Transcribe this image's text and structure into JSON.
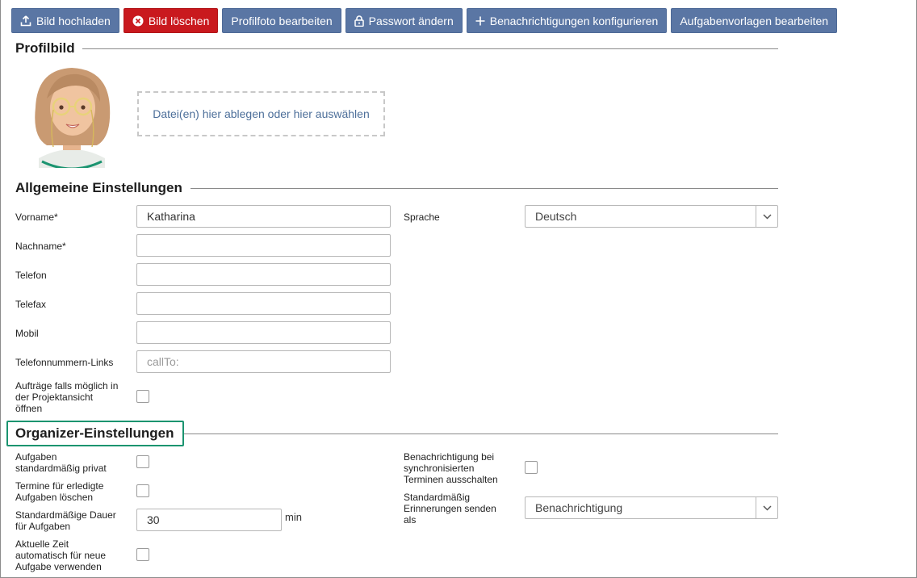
{
  "toolbar": {
    "upload": {
      "label": "Bild hochladen",
      "icon": "upload-icon"
    },
    "delete": {
      "label": "Bild löschen",
      "icon": "close-circle-icon",
      "color": "#c9191e"
    },
    "edit_photo": {
      "label": "Profilfoto bearbeiten"
    },
    "password": {
      "label": "Passwort ändern",
      "icon": "lock-icon"
    },
    "notifications": {
      "label": "Benachrichtigungen konfigurieren",
      "icon": "plus-icon"
    },
    "templates": {
      "label": "Aufgabenvorlagen bearbeiten"
    },
    "accent_color": "#5a76a4"
  },
  "profile": {
    "title": "Profilbild",
    "dropzone_text": "Datei(en) hier ablegen oder hier auswählen"
  },
  "general": {
    "title": "Allgemeine Einstellungen",
    "firstname": {
      "label": "Vorname*",
      "value": "Katharina"
    },
    "lastname": {
      "label": "Nachname*",
      "value": ""
    },
    "phone": {
      "label": "Telefon",
      "value": ""
    },
    "fax": {
      "label": "Telefax",
      "value": ""
    },
    "mobile": {
      "label": "Mobil",
      "value": ""
    },
    "phone_links": {
      "label": "Telefonnummern-Links",
      "placeholder": "callTo:"
    },
    "open_projects": {
      "label_lines": [
        "Aufträge falls möglich in",
        "der Projektansicht",
        "öffnen"
      ],
      "checked": false
    },
    "language": {
      "label": "Sprache",
      "value": "Deutsch"
    }
  },
  "organizer": {
    "title": "Organizer-Einstellungen",
    "highlight_color": "#1b9470",
    "private_default": {
      "label_lines": [
        "Aufgaben",
        "standardmäßig privat"
      ],
      "checked": false
    },
    "delete_done": {
      "label_lines": [
        "Termine für erledigte",
        "Aufgaben löschen"
      ],
      "checked": false
    },
    "default_duration": {
      "label_lines": [
        "Standardmäßige Dauer",
        "für Aufgaben"
      ],
      "value": "30",
      "unit": "min"
    },
    "current_time": {
      "label_lines": [
        "Aktuelle Zeit",
        "automatisch für neue",
        "Aufgabe verwenden"
      ],
      "checked": false
    },
    "sync_notify_off": {
      "label_lines": [
        "Benachrichtigung bei",
        "synchronisierten",
        "Terminen ausschalten"
      ],
      "checked": false
    },
    "reminders": {
      "label_lines": [
        "Standardmäßig",
        "Erinnerungen senden",
        "als"
      ],
      "value": "Benachrichtigung"
    }
  }
}
